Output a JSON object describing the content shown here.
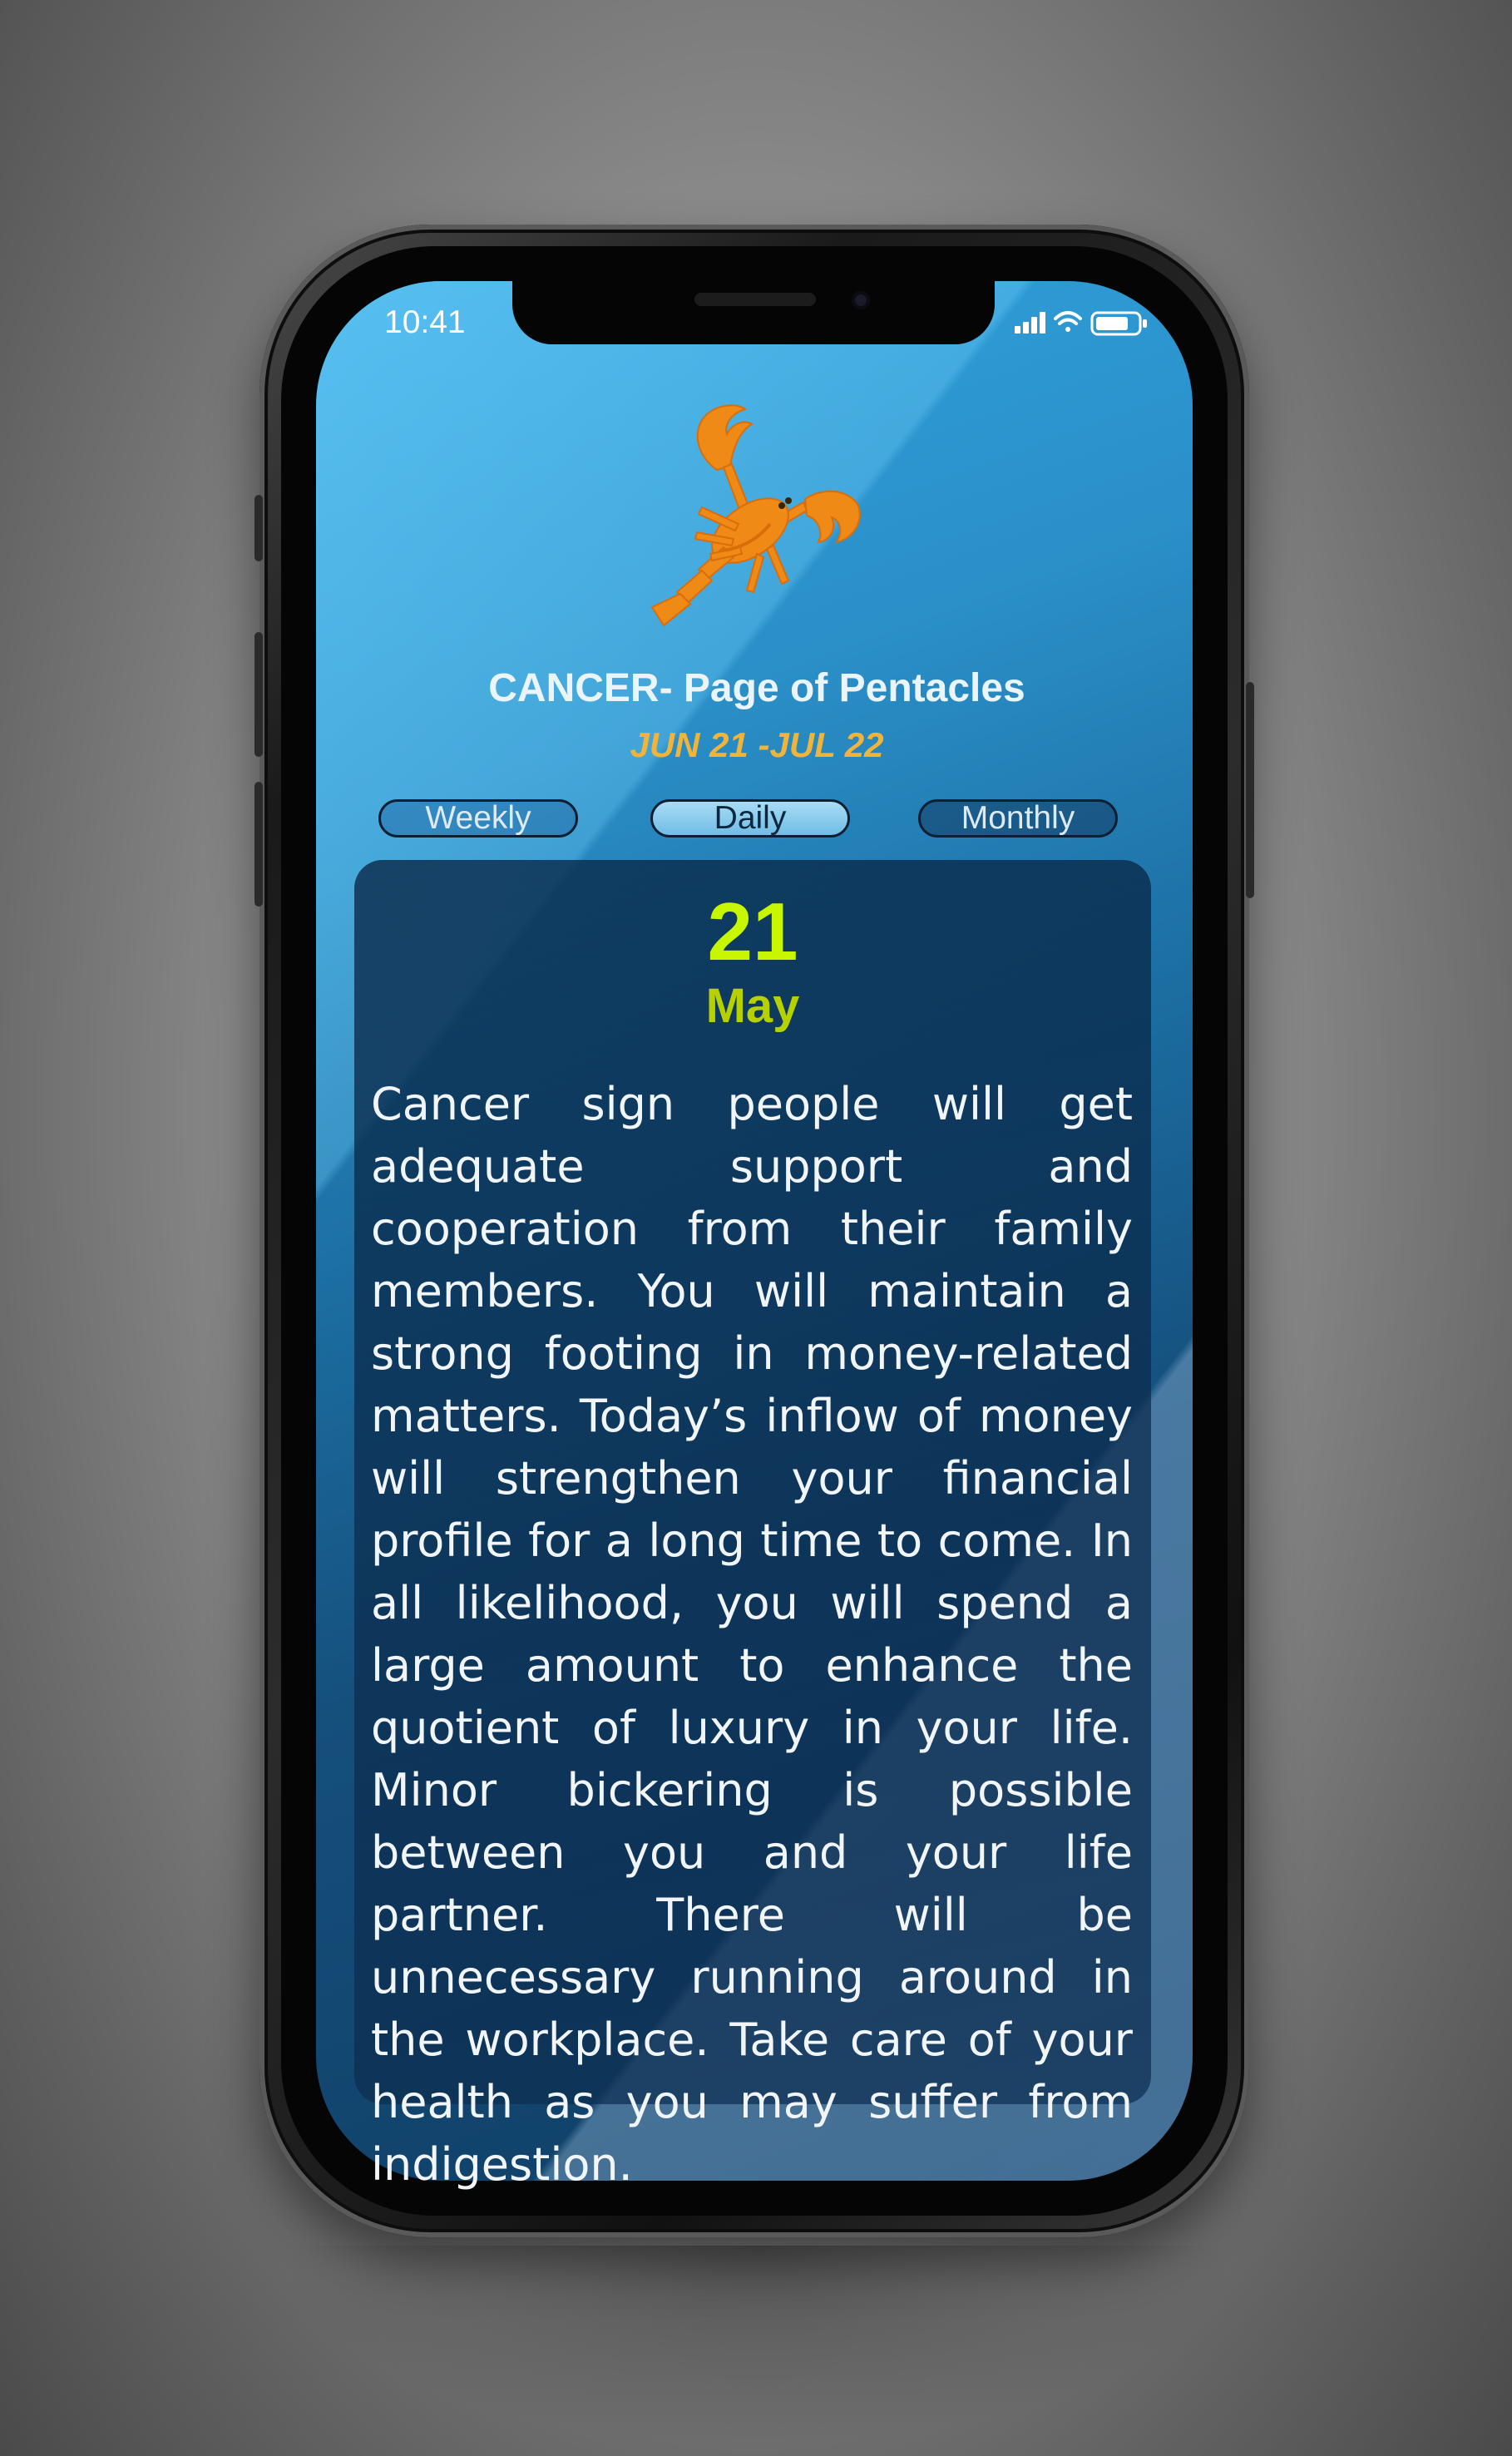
{
  "status_bar": {
    "time": "10:41"
  },
  "sign": {
    "icon": "crab-icon",
    "title": "CANCER- Page of Pentacles",
    "date_range": "JUN 21 -JUL 22"
  },
  "tabs": [
    {
      "label": "Weekly",
      "active": false
    },
    {
      "label": "Daily",
      "active": true
    },
    {
      "label": "Monthly",
      "active": false
    }
  ],
  "reading": {
    "day": "21",
    "month": "May",
    "text": "Cancer sign people will get adequate support and cooperation from their family members. You will maintain a strong footing in money-related matters. Today’s inflow of money will strengthen your financial profile for a long time to come. In all likelihood, you will spend a large amount to enhance the quotient of luxury in your life. Minor bickering is possible between you and your life partner. There will be unnecessary running around in the workplace. Take care of your health as you may suffer from indigestion."
  },
  "colors": {
    "accent_date": "#f0b43a",
    "day_number": "#c8f500",
    "screen_top": "#2fa3df",
    "screen_bottom": "#0f3d63"
  }
}
